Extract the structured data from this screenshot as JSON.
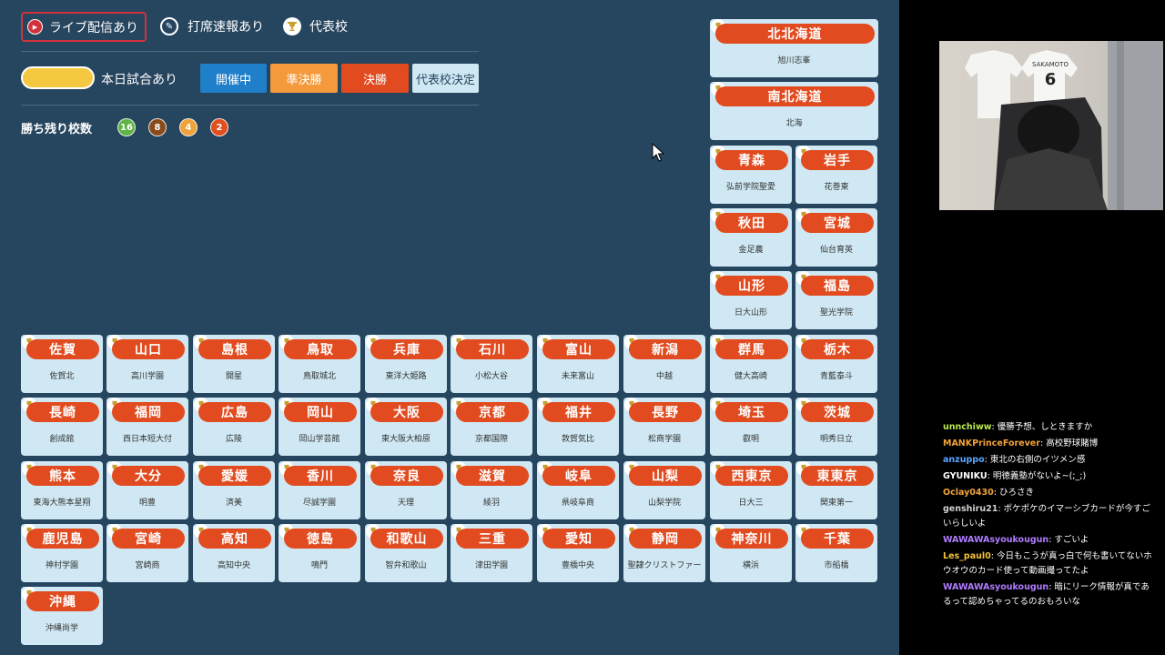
{
  "legend": {
    "live_label": "ライブ配信あり",
    "score_label": "打席速報あり",
    "rep_label": "代表校",
    "today_label": "本日試合あり"
  },
  "status": {
    "ongoing": "開催中",
    "semifinal": "準決勝",
    "final": "決勝",
    "decided": "代表校決定"
  },
  "remaining": {
    "label": "勝ち残り校数",
    "counts": [
      {
        "value": "16",
        "color": "#5fb246"
      },
      {
        "value": "8",
        "color": "#8a4b1c"
      },
      {
        "value": "4",
        "color": "#f0a23c"
      },
      {
        "value": "2",
        "color": "#e04f1d"
      }
    ]
  },
  "colors": {
    "background": "#26455f",
    "card": "#cfe8f3",
    "pref_bar": "#e14b1f",
    "ongoing": "#1f7fc9",
    "semifinal": "#f49a3c",
    "final": "#e14b1f",
    "decided": "#cfe8f3",
    "live_border": "#d2323c",
    "today": "#f5c842"
  },
  "prefectures": {
    "p0": {
      "pref": "北北海道",
      "school": "旭川志峯"
    },
    "p1": {
      "pref": "南北海道",
      "school": "北海"
    },
    "p2": {
      "pref": "青森",
      "school": "弘前学院聖愛"
    },
    "p3": {
      "pref": "岩手",
      "school": "花巻東"
    },
    "p4": {
      "pref": "秋田",
      "school": "金足農"
    },
    "p5": {
      "pref": "宮城",
      "school": "仙台育英"
    },
    "p6": {
      "pref": "山形",
      "school": "日大山形"
    },
    "p7": {
      "pref": "福島",
      "school": "聖光学院"
    },
    "p8": {
      "pref": "佐賀",
      "school": "佐賀北"
    },
    "p9": {
      "pref": "山口",
      "school": "高川学園"
    },
    "p10": {
      "pref": "島根",
      "school": "開星"
    },
    "p11": {
      "pref": "鳥取",
      "school": "鳥取城北"
    },
    "p12": {
      "pref": "兵庫",
      "school": "東洋大姫路"
    },
    "p13": {
      "pref": "石川",
      "school": "小松大谷"
    },
    "p14": {
      "pref": "富山",
      "school": "未来富山"
    },
    "p15": {
      "pref": "新潟",
      "school": "中越"
    },
    "p16": {
      "pref": "群馬",
      "school": "健大高崎"
    },
    "p17": {
      "pref": "栃木",
      "school": "青藍泰斗"
    },
    "p18": {
      "pref": "長崎",
      "school": "創成館"
    },
    "p19": {
      "pref": "福岡",
      "school": "西日本短大付"
    },
    "p20": {
      "pref": "広島",
      "school": "広陵"
    },
    "p21": {
      "pref": "岡山",
      "school": "岡山学芸館"
    },
    "p22": {
      "pref": "大阪",
      "school": "東大阪大柏原"
    },
    "p23": {
      "pref": "京都",
      "school": "京都国際"
    },
    "p24": {
      "pref": "福井",
      "school": "敦賀気比"
    },
    "p25": {
      "pref": "長野",
      "school": "松商学園"
    },
    "p26": {
      "pref": "埼玉",
      "school": "叡明"
    },
    "p27": {
      "pref": "茨城",
      "school": "明秀日立"
    },
    "p28": {
      "pref": "熊本",
      "school": "東海大熊本星翔"
    },
    "p29": {
      "pref": "大分",
      "school": "明豊"
    },
    "p30": {
      "pref": "愛媛",
      "school": "済美"
    },
    "p31": {
      "pref": "香川",
      "school": "尽誠学園"
    },
    "p32": {
      "pref": "奈良",
      "school": "天理"
    },
    "p33": {
      "pref": "滋賀",
      "school": "綾羽"
    },
    "p34": {
      "pref": "岐阜",
      "school": "県岐阜商"
    },
    "p35": {
      "pref": "山梨",
      "school": "山梨学院"
    },
    "p36": {
      "pref": "西東京",
      "school": "日大三"
    },
    "p37": {
      "pref": "東東京",
      "school": "関東第一"
    },
    "p38": {
      "pref": "鹿児島",
      "school": "神村学園"
    },
    "p39": {
      "pref": "宮崎",
      "school": "宮崎商"
    },
    "p40": {
      "pref": "高知",
      "school": "高知中央"
    },
    "p41": {
      "pref": "徳島",
      "school": "鳴門"
    },
    "p42": {
      "pref": "和歌山",
      "school": "智弁和歌山"
    },
    "p43": {
      "pref": "三重",
      "school": "津田学園"
    },
    "p44": {
      "pref": "愛知",
      "school": "豊橋中央"
    },
    "p45": {
      "pref": "静岡",
      "school": "聖隷クリストファー"
    },
    "p46": {
      "pref": "神奈川",
      "school": "横浜"
    },
    "p47": {
      "pref": "千葉",
      "school": "市船橋"
    },
    "p48": {
      "pref": "沖縄",
      "school": "沖縄尚学"
    }
  },
  "webcam": {
    "shirt_text": "SAKAMOTO",
    "shirt_number": "6"
  },
  "chat": [
    {
      "user": "unnchiww",
      "color": "#b9e84a",
      "text": "優勝予想、しときますか"
    },
    {
      "user": "MANKPrinceForever",
      "color": "#f2a33a",
      "text": "高校野球賭博"
    },
    {
      "user": "anzuppo",
      "color": "#58a6ff",
      "text": "東北の右側のイツメン感"
    },
    {
      "user": "GYUNIKU",
      "color": "#ffffff",
      "text": "明徳義塾がないよ~(;_;)"
    },
    {
      "user": "Oclay0430",
      "color": "#f2a33a",
      "text": "ひろさき"
    },
    {
      "user": "genshiru21",
      "color": "#cfcfcf",
      "text": "ポケポケのイマーシブカードが今すごいらしいよ"
    },
    {
      "user": "WAWAWAsyoukougun",
      "color": "#b07cff",
      "text": "すごいよ"
    },
    {
      "user": "Les_paul0",
      "color": "#f2c23a",
      "text": "今日もこうが真っ白で何も書いてないホウオウのカード使って動画撮ってたよ"
    },
    {
      "user": "WAWAWAsyoukougun",
      "color": "#b07cff",
      "text": "暗にリーク情報が真であるって認めちゃってるのおもろいな"
    }
  ]
}
